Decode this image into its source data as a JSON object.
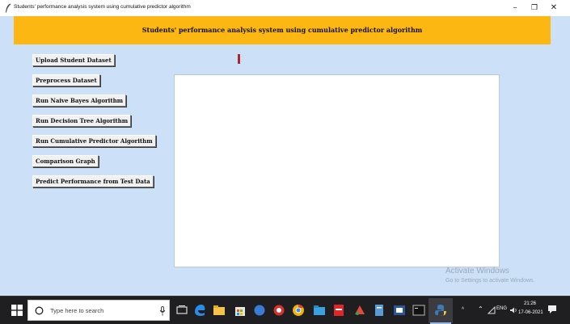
{
  "window": {
    "title": "Students' performance analysis system using cumulative predictor algorithm",
    "minimize_glyph": "–",
    "maximize_glyph": "❐",
    "close_glyph": "✕"
  },
  "header": {
    "title": "Students' performance analysis system using cumulative predictor algorithm"
  },
  "buttons": [
    {
      "label": "Upload Student Dataset"
    },
    {
      "label": "Preprocess Dataset"
    },
    {
      "label": "Run Naive Bayes Algorithm"
    },
    {
      "label": "Run Decision Tree Algorithm"
    },
    {
      "label": "Run Cumulative Predictor Algorithm"
    },
    {
      "label": "Comparison Graph"
    },
    {
      "label": "Predict Performance from Test Data"
    }
  ],
  "watermark": {
    "line1": "Activate Windows",
    "line2": "Go to Settings to activate Windows."
  },
  "taskbar": {
    "search_placeholder": "Type here to search",
    "time": "21:26",
    "date": "17-06-2021",
    "lang": "ENG"
  },
  "colors": {
    "header_band": "#fcb712",
    "app_background": "#cce0f7",
    "marker": "#b0272d"
  }
}
